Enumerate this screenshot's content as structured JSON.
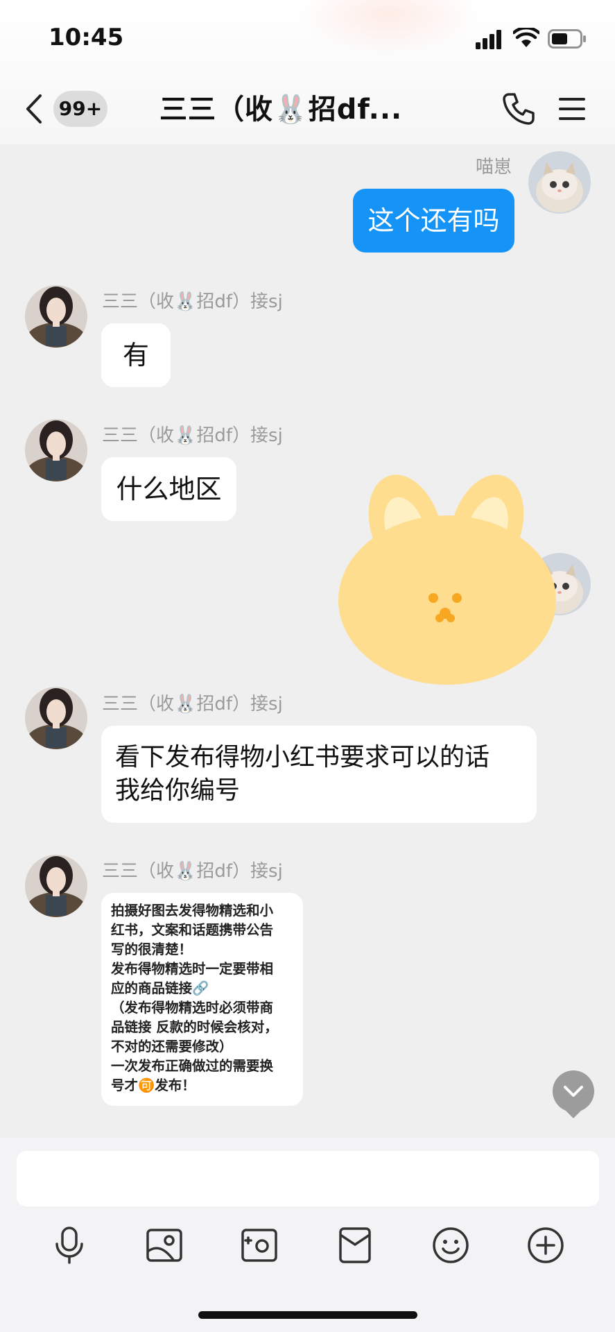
{
  "status_bar": {
    "time": "10:45"
  },
  "header": {
    "unread_badge": "99+",
    "title": "三三（收🐰招df...",
    "icons": [
      "back-chevron-icon",
      "phone-icon",
      "menu-icon"
    ]
  },
  "messages": [
    {
      "side": "right",
      "sender": "喵崽",
      "text": "这个还有吗"
    },
    {
      "side": "left",
      "sender": "三三（收🐰招df）接sj",
      "text": "有"
    },
    {
      "side": "left",
      "sender": "三三（收🐰招df）接sj",
      "text": "什么地区"
    },
    {
      "side": "right",
      "sticker": "yellow-bunny-sticker"
    },
    {
      "side": "left",
      "sender": "三三（收🐰招df）接sj",
      "lines": [
        "看下发布得物小红书要求可以的话",
        "我给你编号"
      ]
    },
    {
      "side": "left",
      "sender": "三三（收🐰招df）接sj",
      "lines": [
        "拍摄好图去发得物精选和小",
        "红书，文案和话题携带公告",
        "写的很清楚！",
        "发布得物精选时一定要带相",
        "应的商品链接🔗",
        "（发布得物精选时必须带商",
        "品链接 反款的时候会核对，",
        "不对的还需要修改）",
        "一次发布正确做过的需要换",
        "号才🉑发布！"
      ]
    }
  ],
  "toolbar": {
    "icons": [
      "microphone-icon",
      "photo-icon",
      "camera-icon",
      "red-packet-icon",
      "emoji-icon",
      "plus-icon"
    ]
  },
  "colors": {
    "accent_blue": "#1593f6",
    "chat_bg": "#efefef",
    "bubble_white": "#ffffff"
  }
}
